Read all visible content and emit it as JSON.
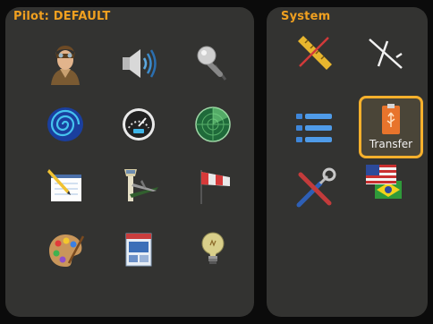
{
  "pilot_panel": {
    "title": "Pilot: DEFAULT",
    "icons": [
      "pilot-icon",
      "speaker-icon",
      "microphone-icon",
      "vortex-icon",
      "gauge-icon",
      "radar-icon",
      "notepad-icon",
      "airport-tower-icon",
      "windsock-icon",
      "palette-icon",
      "layout-icon",
      "lightbulb-icon"
    ]
  },
  "system_panel": {
    "title": "System",
    "icons": [
      "ruler-icon",
      "glider-icon",
      "list-icon",
      "transfer-icon",
      "tools-icon",
      "flags-icon"
    ],
    "transfer_label": "Transfer"
  },
  "colors": {
    "accent": "#f0a020",
    "panel": "#333331",
    "background": "#0b0b0b",
    "selection_border": "#f6b02c"
  }
}
